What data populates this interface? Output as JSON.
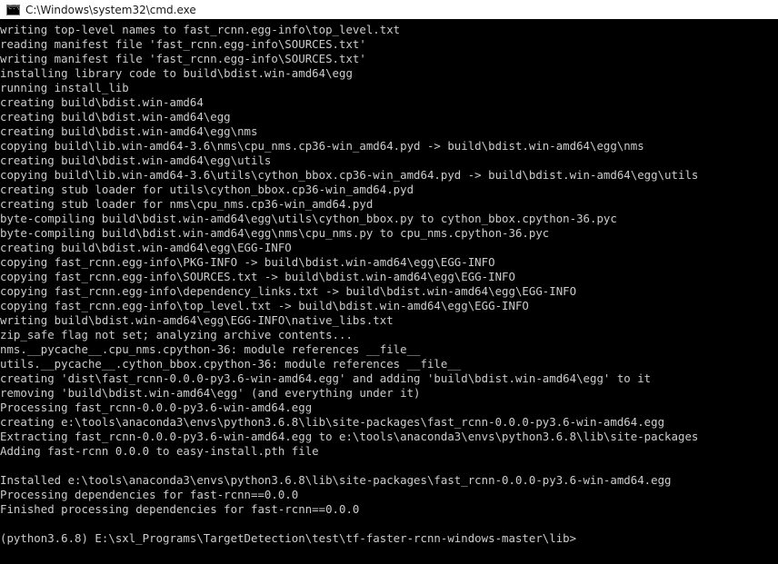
{
  "window": {
    "title": "C:\\Windows\\system32\\cmd.exe",
    "icon": "cmd-icon"
  },
  "colors": {
    "background": "#000000",
    "text": "#cccccc",
    "titlebar": "#ffffff"
  },
  "console": {
    "lines": [
      "writing top-level names to fast_rcnn.egg-info\\top_level.txt",
      "reading manifest file 'fast_rcnn.egg-info\\SOURCES.txt'",
      "writing manifest file 'fast_rcnn.egg-info\\SOURCES.txt'",
      "installing library code to build\\bdist.win-amd64\\egg",
      "running install_lib",
      "creating build\\bdist.win-amd64",
      "creating build\\bdist.win-amd64\\egg",
      "creating build\\bdist.win-amd64\\egg\\nms",
      "copying build\\lib.win-amd64-3.6\\nms\\cpu_nms.cp36-win_amd64.pyd -> build\\bdist.win-amd64\\egg\\nms",
      "creating build\\bdist.win-amd64\\egg\\utils",
      "copying build\\lib.win-amd64-3.6\\utils\\cython_bbox.cp36-win_amd64.pyd -> build\\bdist.win-amd64\\egg\\utils",
      "creating stub loader for utils\\cython_bbox.cp36-win_amd64.pyd",
      "creating stub loader for nms\\cpu_nms.cp36-win_amd64.pyd",
      "byte-compiling build\\bdist.win-amd64\\egg\\utils\\cython_bbox.py to cython_bbox.cpython-36.pyc",
      "byte-compiling build\\bdist.win-amd64\\egg\\nms\\cpu_nms.py to cpu_nms.cpython-36.pyc",
      "creating build\\bdist.win-amd64\\egg\\EGG-INFO",
      "copying fast_rcnn.egg-info\\PKG-INFO -> build\\bdist.win-amd64\\egg\\EGG-INFO",
      "copying fast_rcnn.egg-info\\SOURCES.txt -> build\\bdist.win-amd64\\egg\\EGG-INFO",
      "copying fast_rcnn.egg-info\\dependency_links.txt -> build\\bdist.win-amd64\\egg\\EGG-INFO",
      "copying fast_rcnn.egg-info\\top_level.txt -> build\\bdist.win-amd64\\egg\\EGG-INFO",
      "writing build\\bdist.win-amd64\\egg\\EGG-INFO\\native_libs.txt",
      "zip_safe flag not set; analyzing archive contents...",
      "nms.__pycache__.cpu_nms.cpython-36: module references __file__",
      "utils.__pycache__.cython_bbox.cpython-36: module references __file__",
      "creating 'dist\\fast_rcnn-0.0.0-py3.6-win-amd64.egg' and adding 'build\\bdist.win-amd64\\egg' to it",
      "removing 'build\\bdist.win-amd64\\egg' (and everything under it)",
      "Processing fast_rcnn-0.0.0-py3.6-win-amd64.egg",
      "creating e:\\tools\\anaconda3\\envs\\python3.6.8\\lib\\site-packages\\fast_rcnn-0.0.0-py3.6-win-amd64.egg",
      "Extracting fast_rcnn-0.0.0-py3.6-win-amd64.egg to e:\\tools\\anaconda3\\envs\\python3.6.8\\lib\\site-packages",
      "Adding fast-rcnn 0.0.0 to easy-install.pth file",
      "",
      "Installed e:\\tools\\anaconda3\\envs\\python3.6.8\\lib\\site-packages\\fast_rcnn-0.0.0-py3.6-win-amd64.egg",
      "Processing dependencies for fast-rcnn==0.0.0",
      "Finished processing dependencies for fast-rcnn==0.0.0",
      "",
      "(python3.6.8) E:\\sxl_Programs\\TargetDetection\\test\\tf-faster-rcnn-windows-master\\lib>"
    ]
  }
}
